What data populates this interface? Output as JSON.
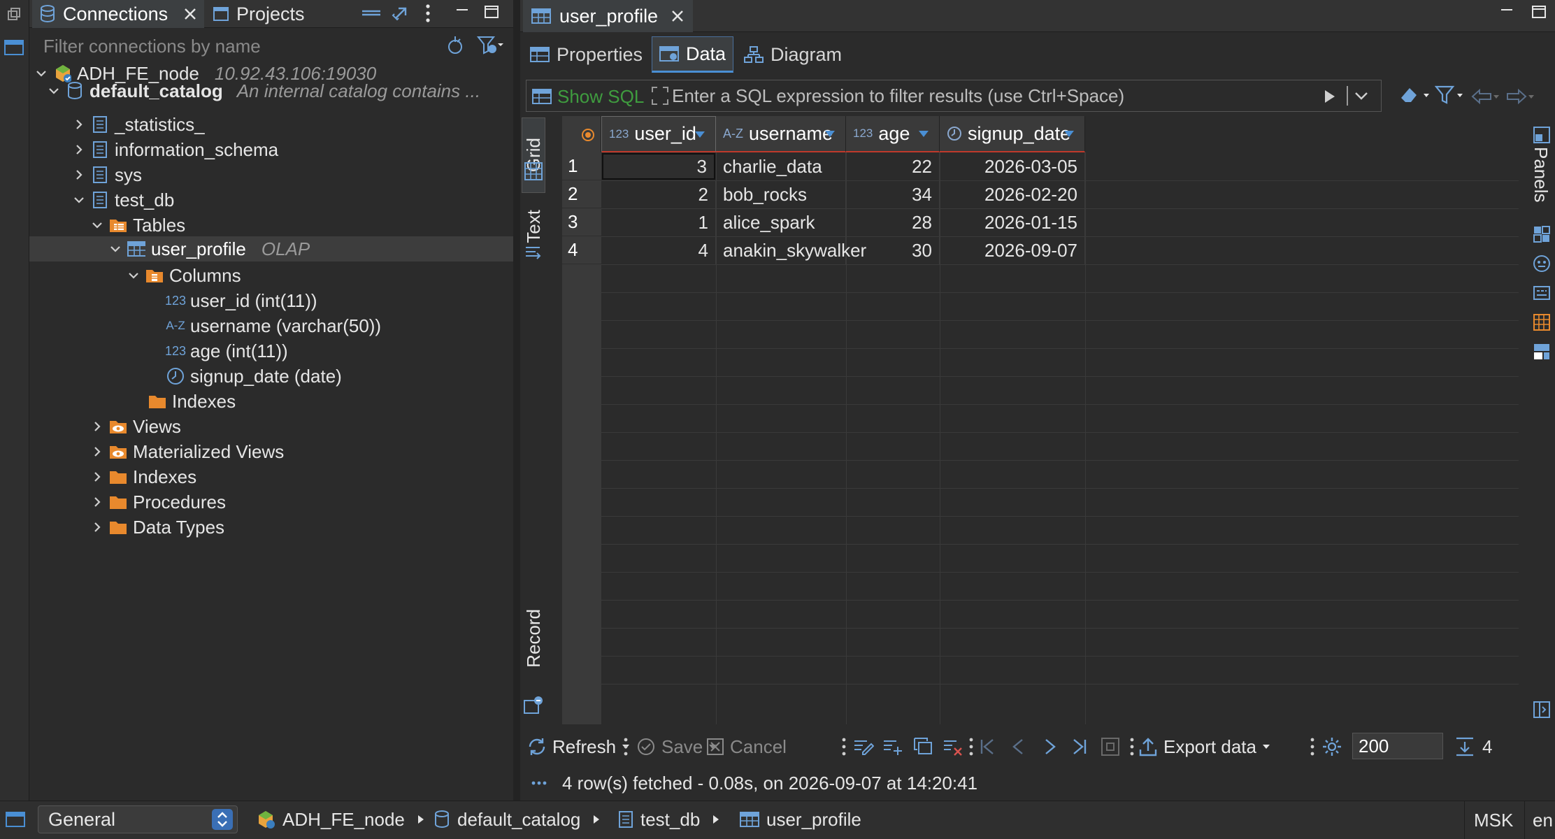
{
  "left_panel": {
    "tabs": [
      {
        "label": "Connections",
        "icon": "connections-icon",
        "active": true
      },
      {
        "label": "Projects",
        "icon": "projects-icon",
        "active": false
      }
    ],
    "filter_placeholder": "Filter connections by name",
    "tree": {
      "connection": {
        "name": "ADH_FE_node",
        "address": "10.92.43.106:19030"
      },
      "catalog": {
        "name": "default_catalog",
        "description": "An internal catalog contains ..."
      },
      "schemas": [
        "_statistics_",
        "information_schema",
        "sys",
        "test_db"
      ],
      "tables_label": "Tables",
      "table": {
        "name": "user_profile",
        "engine": "OLAP"
      },
      "columns_label": "Columns",
      "columns": [
        {
          "type_icon": "123",
          "label": "user_id (int(11))"
        },
        {
          "type_icon": "A-Z",
          "label": "username (varchar(50))"
        },
        {
          "type_icon": "123",
          "label": "age (int(11))"
        },
        {
          "type_icon": "clock",
          "label": "signup_date (date)"
        }
      ],
      "indexes_label": "Indexes",
      "schema_folders": [
        "Views",
        "Materialized Views",
        "Indexes",
        "Procedures",
        "Data Types"
      ]
    }
  },
  "editor": {
    "tab_title": "user_profile",
    "subtabs": [
      {
        "label": "Properties",
        "active": false
      },
      {
        "label": "Data",
        "active": true
      },
      {
        "label": "Diagram",
        "active": false
      }
    ],
    "show_sql_label": "Show SQL",
    "filter_placeholder": "Enter a SQL expression to filter results (use Ctrl+Space)",
    "side_tabs": [
      "Grid",
      "Text",
      "Record"
    ],
    "panels_label": "Panels",
    "grid": {
      "columns": [
        {
          "type_icon": "123",
          "name": "user_id"
        },
        {
          "type_icon": "A-Z",
          "name": "username"
        },
        {
          "type_icon": "123",
          "name": "age"
        },
        {
          "type_icon": "clock",
          "name": "signup_date"
        }
      ],
      "rows": [
        {
          "num": "1",
          "user_id": "3",
          "username": "charlie_data",
          "age": "22",
          "signup_date": "2026-03-05"
        },
        {
          "num": "2",
          "user_id": "2",
          "username": "bob_rocks",
          "age": "34",
          "signup_date": "2026-02-20"
        },
        {
          "num": "3",
          "user_id": "1",
          "username": "alice_spark",
          "age": "28",
          "signup_date": "2026-01-15"
        },
        {
          "num": "4",
          "user_id": "4",
          "username": "anakin_skywalker",
          "age": "30",
          "signup_date": "2026-09-07"
        }
      ]
    },
    "toolbar": {
      "refresh": "Refresh",
      "save": "Save",
      "cancel": "Cancel",
      "export": "Export data",
      "limit": "200",
      "row_count": "4"
    },
    "status": "4 row(s) fetched - 0.08s, on 2026-09-07 at 14:20:41"
  },
  "statusbar": {
    "general": "General",
    "breadcrumbs": [
      "ADH_FE_node",
      "default_catalog",
      "test_db",
      "user_profile"
    ],
    "timezone": "MSK",
    "locale": "en"
  },
  "colors": {
    "accent": "#4a8fd4",
    "folder": "#e8892d",
    "show_sql_green": "#3f9c3f",
    "header_underline": "#c0392b"
  }
}
